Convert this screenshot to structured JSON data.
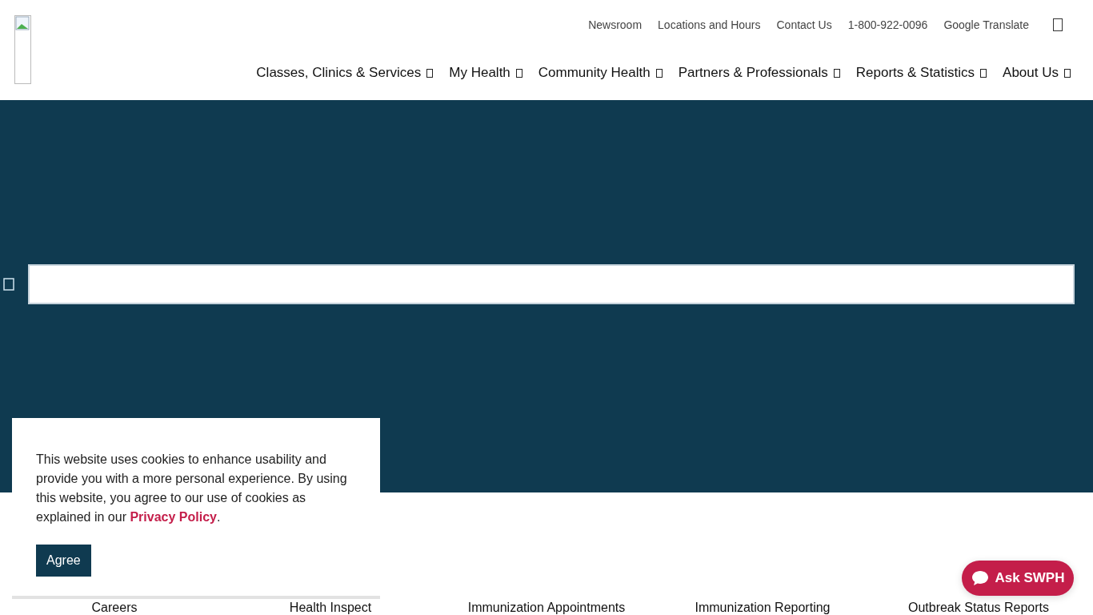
{
  "header": {
    "utility_links": [
      "Newsroom",
      "Locations and Hours",
      "Contact Us",
      "1-800-922-0096",
      "Google Translate"
    ],
    "nav": [
      {
        "label": "Classes, Clinics & Services"
      },
      {
        "label": "My Health"
      },
      {
        "label": "Community Health"
      },
      {
        "label": "Partners & Professionals"
      },
      {
        "label": "Reports & Statistics"
      },
      {
        "label": "About Us"
      }
    ]
  },
  "quick_links": [
    "Careers",
    "Health Inspect",
    "Immunization Appointments",
    "Immunization Reporting",
    "Outbreak Status Reports"
  ],
  "cookie_banner": {
    "text": "This website uses cookies to enhance usability and provide you with a more personal experience. By using this website, you agree to our use of cookies as explained in our ",
    "link": "Privacy Policy",
    "text_after": ".",
    "button": "Agree"
  },
  "chat_button": "Ask SWPH"
}
